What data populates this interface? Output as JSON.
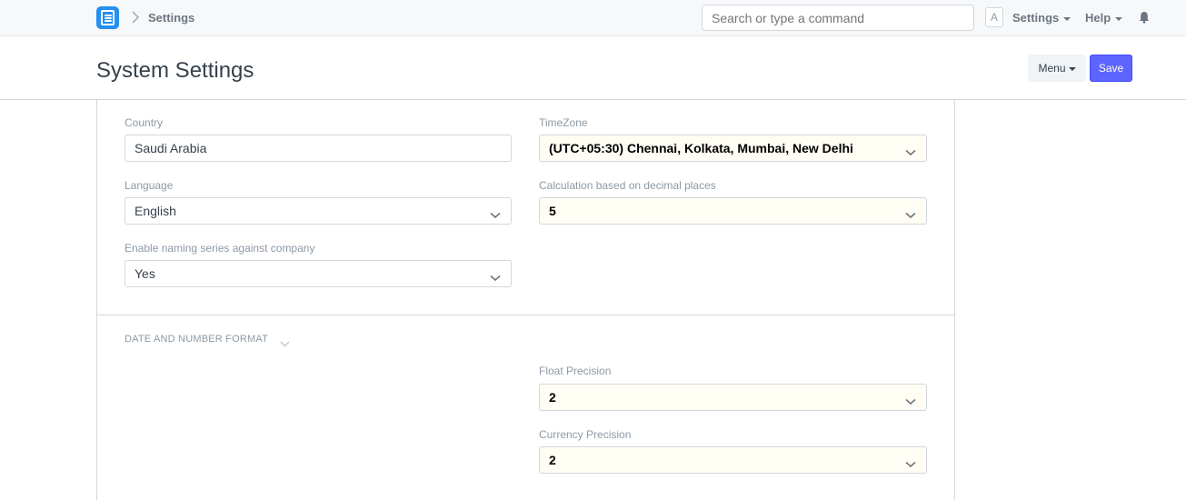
{
  "navbar": {
    "breadcrumb": "Settings",
    "search_placeholder": "Search or type a command",
    "avatar_initial": "A",
    "settings_label": "Settings",
    "help_label": "Help"
  },
  "page": {
    "title": "System Settings",
    "menu_label": "Menu",
    "save_label": "Save"
  },
  "form": {
    "country": {
      "label": "Country",
      "value": "Saudi Arabia"
    },
    "timezone": {
      "label": "TimeZone",
      "value": "(UTC+05:30) Chennai, Kolkata, Mumbai, New Delhi"
    },
    "language": {
      "label": "Language",
      "value": "English"
    },
    "decimal_places": {
      "label": "Calculation based on decimal places",
      "value": "5"
    },
    "naming_series": {
      "label": "Enable naming series against company",
      "value": "Yes"
    },
    "date_number_section": "DATE AND NUMBER FORMAT",
    "float_precision": {
      "label": "Float Precision",
      "value": "2"
    },
    "currency_precision": {
      "label": "Currency Precision",
      "value": "2"
    }
  },
  "colors": {
    "primary": "#5e64ff",
    "logo": "#2490ef",
    "highlight_bg": "#fffdf4",
    "border": "#d1d8dd"
  }
}
